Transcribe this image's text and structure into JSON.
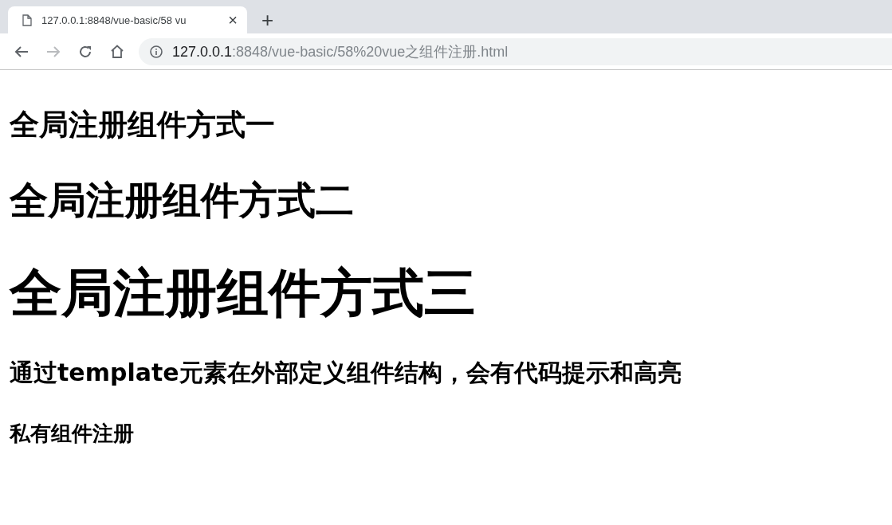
{
  "tab": {
    "title": "127.0.0.1:8848/vue-basic/58 vu",
    "close": "×",
    "new_tab": "+"
  },
  "toolbar": {
    "forward_disabled": true,
    "url_host": "127.0.0.1",
    "url_path": ":8848/vue-basic/58%20vue之组件注册.html"
  },
  "headings": [
    {
      "kind": "h2",
      "text": "全局注册组件方式一"
    },
    {
      "kind": "h1",
      "text": "全局注册组件方式二"
    },
    {
      "kind": "big",
      "text": "全局注册组件方式三"
    },
    {
      "kind": "h3",
      "text": "通过template元素在外部定义组件结构，会有代码提示和高亮"
    },
    {
      "kind": "h4",
      "text": "私有组件注册"
    }
  ]
}
